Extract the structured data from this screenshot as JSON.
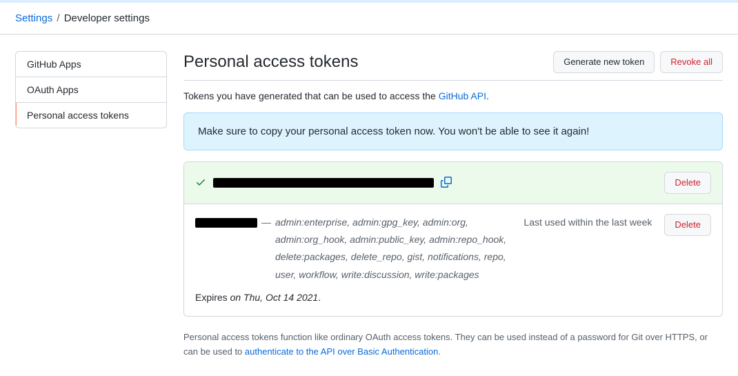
{
  "breadcrumb": {
    "root": "Settings",
    "sep": "/",
    "current": "Developer settings"
  },
  "sidenav": {
    "items": [
      {
        "label": "GitHub Apps",
        "active": false
      },
      {
        "label": "OAuth Apps",
        "active": false
      },
      {
        "label": "Personal access tokens",
        "active": true
      }
    ]
  },
  "header": {
    "title": "Personal access tokens",
    "generate_label": "Generate new token",
    "revoke_label": "Revoke all"
  },
  "intro": {
    "prefix": "Tokens you have generated that can be used to access the ",
    "link_text": "GitHub API",
    "suffix": "."
  },
  "flash": {
    "message": "Make sure to copy your personal access token now. You won't be able to see it again!"
  },
  "new_token": {
    "delete_label": "Delete"
  },
  "existing_token": {
    "scopes": "admin:enterprise, admin:gpg_key, admin:org, admin:org_hook, admin:public_key, admin:repo_hook, delete:packages, delete_repo, gist, notifications, repo, user, workflow, write:discussion, write:packages",
    "last_used": "Last used within the last week",
    "delete_label": "Delete",
    "expires_prefix": "Expires ",
    "expires_date": "on Thu, Oct 14 2021",
    "expires_suffix": "."
  },
  "footer": {
    "text": "Personal access tokens function like ordinary OAuth access tokens. They can be used instead of a password for Git over HTTPS, or can be used to ",
    "link_text": "authenticate to the API over Basic Authentication",
    "suffix": "."
  }
}
